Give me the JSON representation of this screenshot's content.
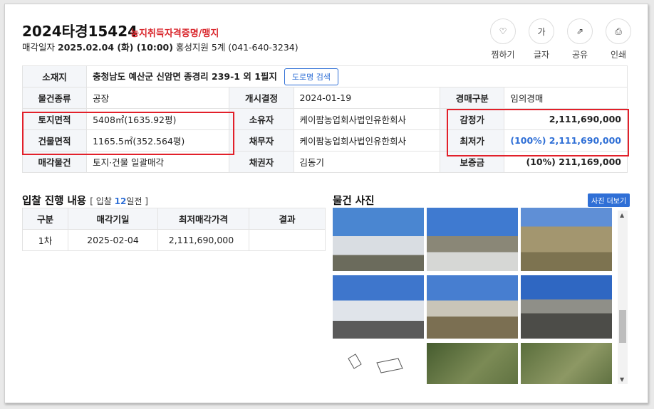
{
  "header": {
    "case_no": "2024타경15424",
    "tag": "농지취득자격증명/맹지",
    "sale_label": "매각일자",
    "sale_date": "2025.02.04 (화) (10:00)",
    "court": "홍성지원 5계 (041-640-3234)"
  },
  "actions": [
    {
      "icon": "heart-icon",
      "glyph": "♡",
      "label": "찜하기"
    },
    {
      "icon": "font-size-icon",
      "glyph": "가",
      "label": "글자"
    },
    {
      "icon": "share-icon",
      "glyph": "⇗",
      "label": "공유"
    },
    {
      "icon": "print-icon",
      "glyph": "⎙",
      "label": "인쇄"
    }
  ],
  "info": {
    "loc_label": "소재지",
    "loc_value": "충청남도 예산군 신암면 종경리 239-1 외 1필지",
    "road_btn": "도로명 검색",
    "type_label": "물건종류",
    "type_value": "공장",
    "open_label": "개시결정",
    "open_value": "2024-01-19",
    "auc_label": "경매구분",
    "auc_value": "임의경매",
    "land_label": "토지면적",
    "land_value": "5408㎡(1635.92평)",
    "owner_label": "소유자",
    "owner_value": "케이팜농업회사법인유한회사",
    "appr_label": "감정가",
    "appr_value": "2,111,690,000",
    "bldg_label": "건물면적",
    "bldg_value": "1165.5㎡(352.564평)",
    "debtor_label": "채무자",
    "debtor_value": "케이팜농업회사법인유한회사",
    "min_label": "최저가",
    "min_value": "(100%) 2,111,690,000",
    "sale_label": "매각물건",
    "sale_value": "토지·건물 일괄매각",
    "creditor_label": "채권자",
    "creditor_value": "김동기",
    "dep_label": "보증금",
    "dep_value": "(10%) 211,169,000"
  },
  "bidding": {
    "title": "입찰 진행 내용",
    "days_prefix": "[ 입찰",
    "days": "12",
    "days_suffix": "일전 ]",
    "headers": [
      "구분",
      "매각기일",
      "최저매각가격",
      "결과"
    ],
    "rows": [
      [
        "1차",
        "2025-02-04",
        "2,111,690,000",
        ""
      ]
    ]
  },
  "photos": {
    "title": "물건 사진",
    "more": "사진 더보기"
  },
  "colors": {
    "accent": "#2f6fd6",
    "red": "#d9262c"
  }
}
